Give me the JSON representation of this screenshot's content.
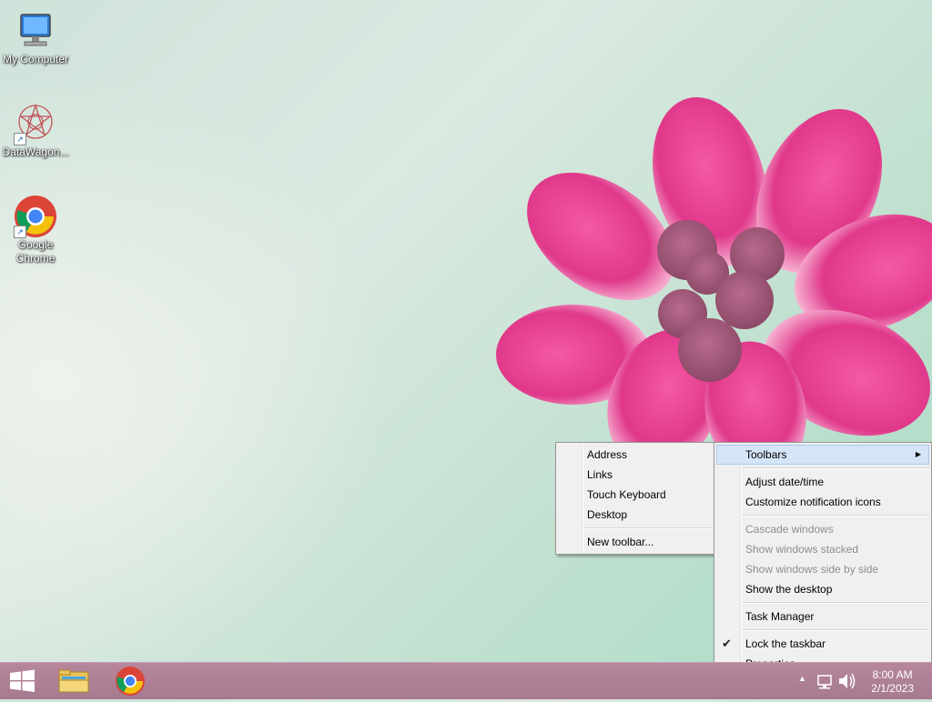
{
  "desktop": {
    "icons": [
      {
        "label": "My Computer"
      },
      {
        "label": "DataWagon..."
      },
      {
        "label": "Google Chrome"
      }
    ]
  },
  "toolbars_submenu": {
    "items": [
      "Address",
      "Links",
      "Touch Keyboard",
      "Desktop"
    ],
    "new_toolbar": "New toolbar..."
  },
  "taskbar_menu": {
    "toolbars": "Toolbars",
    "adjust_datetime": "Adjust date/time",
    "customize_icons": "Customize notification icons",
    "cascade": "Cascade windows",
    "stacked": "Show windows stacked",
    "side_by_side": "Show windows side by side",
    "show_desktop": "Show the desktop",
    "task_manager": "Task Manager",
    "lock_taskbar": "Lock the taskbar",
    "properties": "Properties"
  },
  "clock": {
    "time": "8:00 AM",
    "date": "2/1/2023"
  },
  "colors": {
    "taskbar": "#a67a8f",
    "menu_bg": "#f0f0f0",
    "highlight": "#d5e5f7"
  }
}
